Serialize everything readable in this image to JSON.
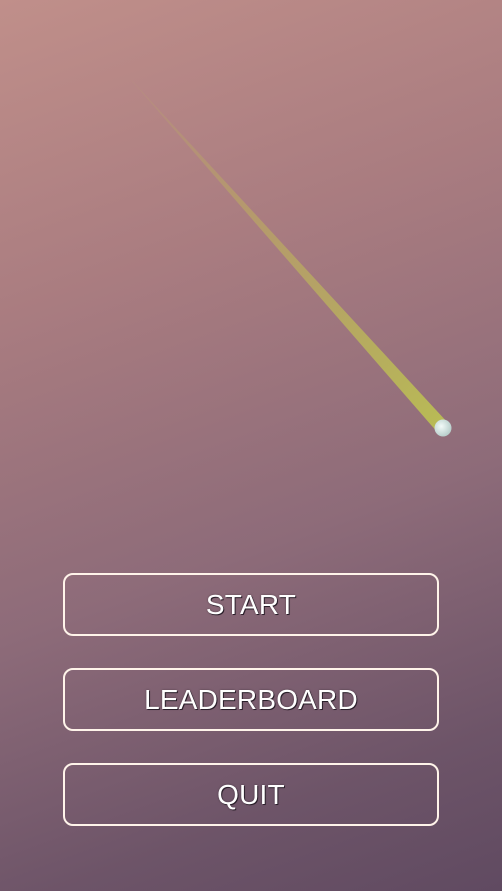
{
  "menu": {
    "start_label": "START",
    "leaderboard_label": "LEADERBOARD",
    "quit_label": "QUIT"
  },
  "colors": {
    "trail": "#b8b25c",
    "ball": "#dcebe8",
    "button_border": "#fff4ea",
    "button_text": "#ffffff"
  }
}
